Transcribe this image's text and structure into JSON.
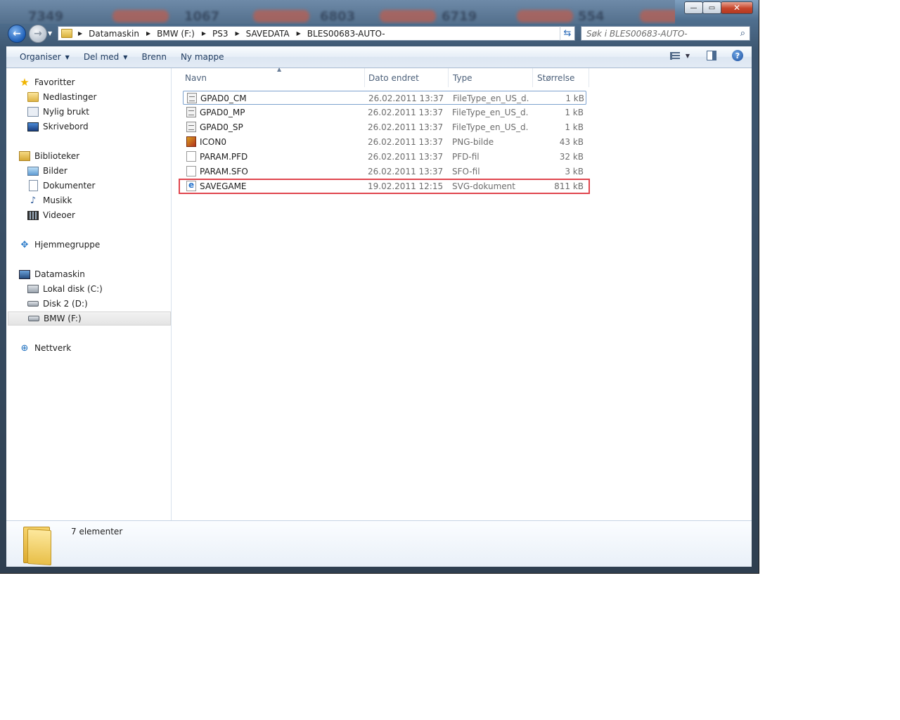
{
  "titlebar": {
    "blurred_numbers": [
      "7349",
      "1067",
      "6803",
      "6719",
      "554"
    ],
    "controls": {
      "minimize": "—",
      "maximize": "▭",
      "close": "✕"
    }
  },
  "address": {
    "crumbs": [
      "Datamaskin",
      "BMW (F:)",
      "PS3",
      "SAVEDATA",
      "BLES00683-AUTO-"
    ]
  },
  "search": {
    "placeholder": "Søk i BLES00683-AUTO-"
  },
  "toolbar": {
    "organize": "Organiser",
    "share": "Del med",
    "burn": "Brenn",
    "new_folder": "Ny mappe"
  },
  "navpane": {
    "favorites": {
      "label": "Favoritter",
      "items": [
        "Nedlastinger",
        "Nylig brukt",
        "Skrivebord"
      ]
    },
    "libraries": {
      "label": "Biblioteker",
      "items": [
        "Bilder",
        "Dokumenter",
        "Musikk",
        "Videoer"
      ]
    },
    "homegroup": {
      "label": "Hjemmegruppe"
    },
    "computer": {
      "label": "Datamaskin",
      "items": [
        "Lokal disk (C:)",
        "Disk 2 (D:)",
        "BMW (F:)"
      ],
      "selected": "BMW (F:)"
    },
    "network": {
      "label": "Nettverk"
    }
  },
  "columns": {
    "name": "Navn",
    "date": "Dato endret",
    "type": "Type",
    "size": "Størrelse"
  },
  "files": [
    {
      "name": "GPAD0_CM",
      "date": "26.02.2011 13:37",
      "type": "FileType_en_US_d...",
      "size": "1 kB",
      "icon": "generic-file-icon"
    },
    {
      "name": "GPAD0_MP",
      "date": "26.02.2011 13:37",
      "type": "FileType_en_US_d...",
      "size": "1 kB",
      "icon": "generic-file-icon"
    },
    {
      "name": "GPAD0_SP",
      "date": "26.02.2011 13:37",
      "type": "FileType_en_US_d...",
      "size": "1 kB",
      "icon": "generic-file-icon"
    },
    {
      "name": "ICON0",
      "date": "26.02.2011 13:37",
      "type": "PNG-bilde",
      "size": "43 kB",
      "icon": "png-file-icon"
    },
    {
      "name": "PARAM.PFD",
      "date": "26.02.2011 13:37",
      "type": "PFD-fil",
      "size": "32 kB",
      "icon": "blank-file-icon"
    },
    {
      "name": "PARAM.SFO",
      "date": "26.02.2011 13:37",
      "type": "SFO-fil",
      "size": "3 kB",
      "icon": "blank-file-icon"
    },
    {
      "name": "SAVEGAME",
      "date": "19.02.2011 12:15",
      "type": "SVG-dokument",
      "size": "811 kB",
      "icon": "svg-file-icon"
    }
  ],
  "details": {
    "count": "7 elementer"
  },
  "colors": {
    "highlight": "#e0464e",
    "accent": "#1e5fb8"
  }
}
